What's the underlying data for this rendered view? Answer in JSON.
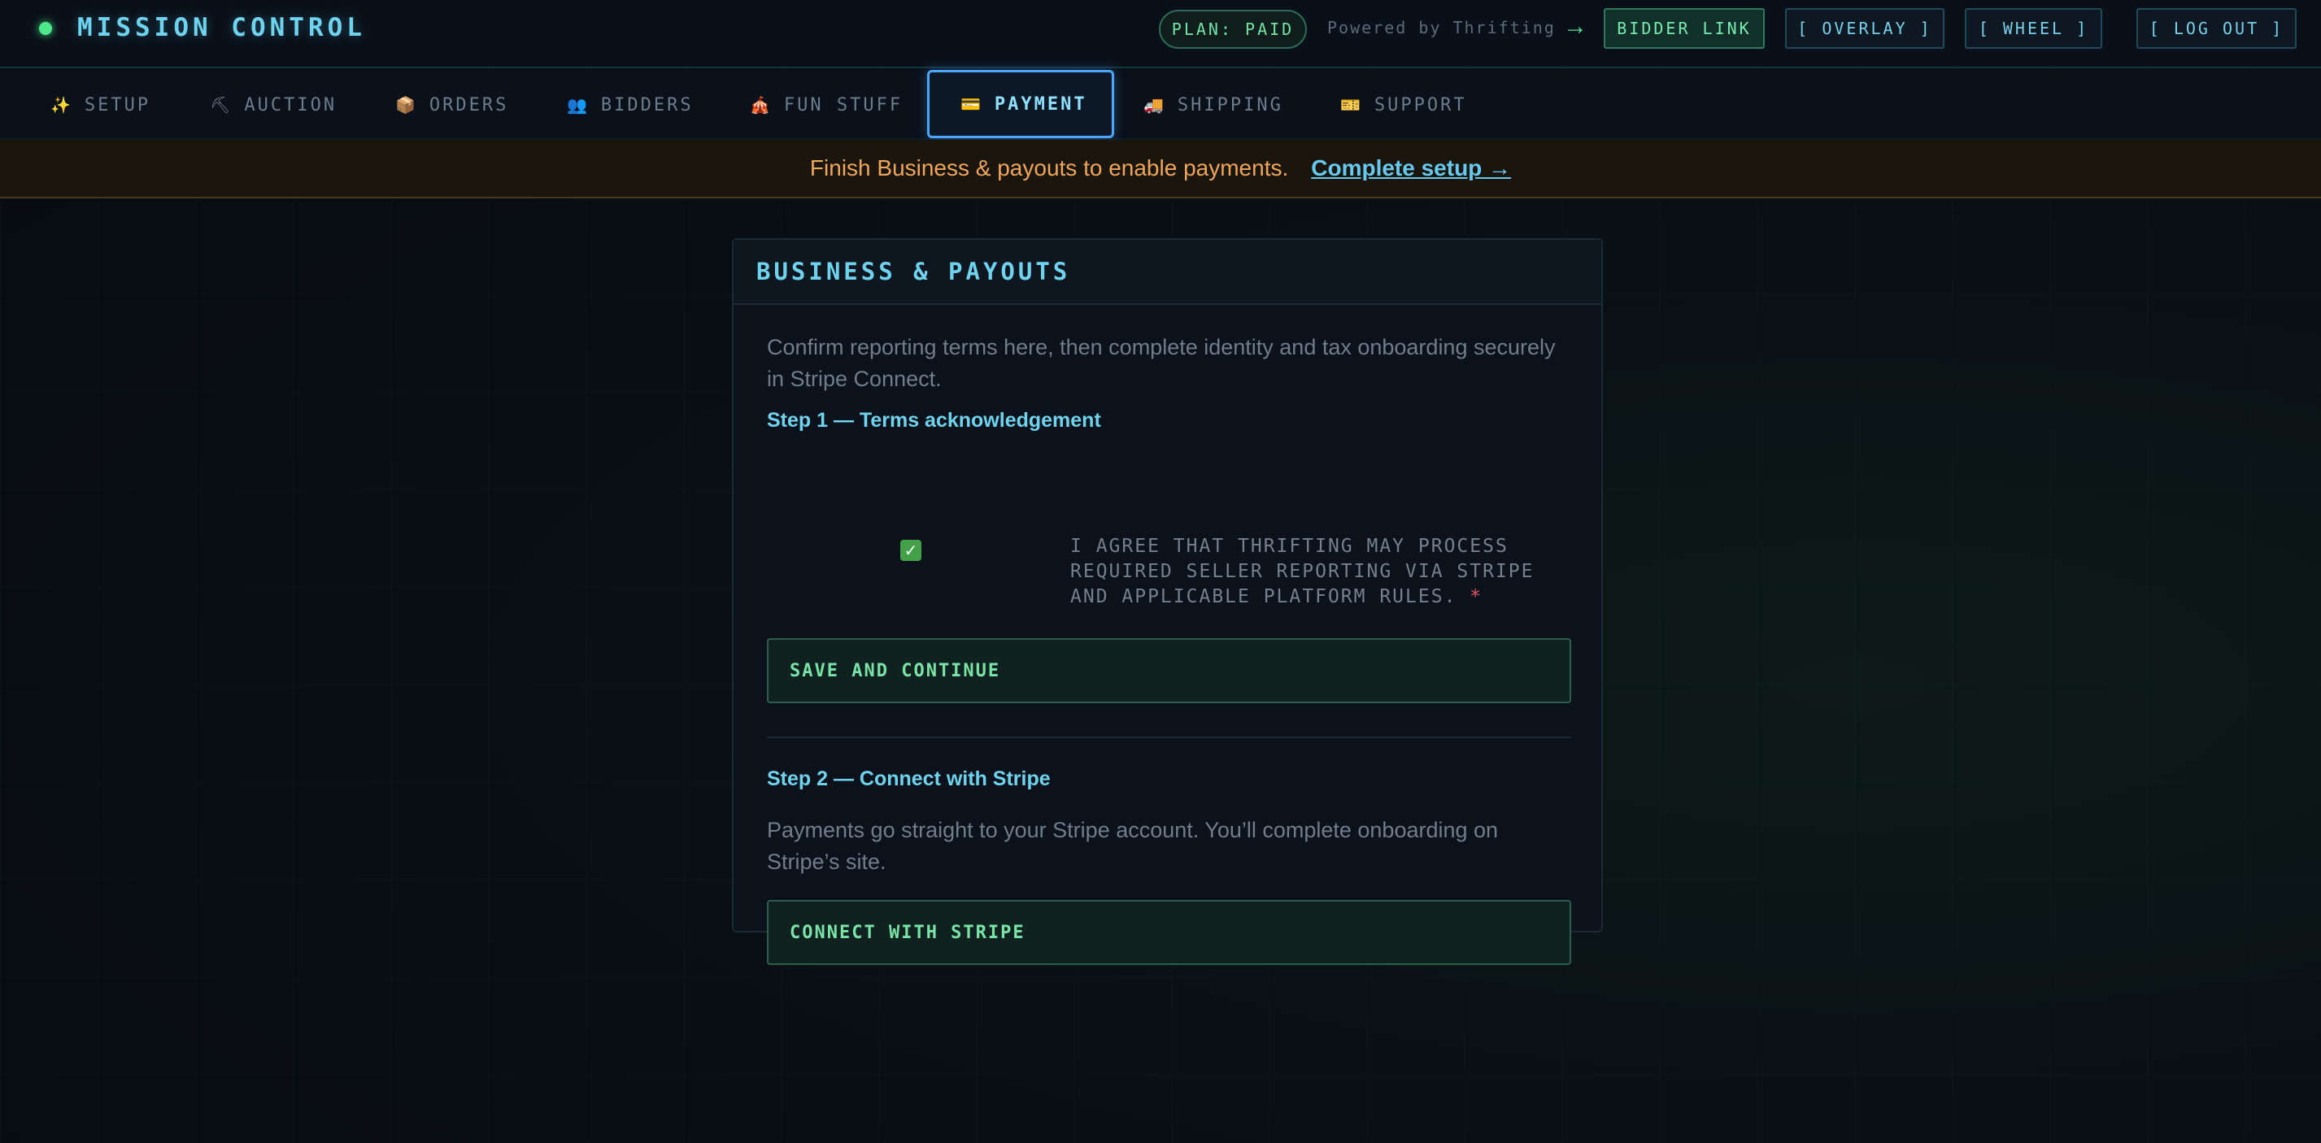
{
  "header": {
    "brand": "MISSION CONTROL",
    "plan": "PLAN: PAID",
    "powered_by": "Powered by Thrifting",
    "buttons": {
      "bidder_link": "BIDDER LINK",
      "overlay": "[ OVERLAY ]",
      "wheel": "[ WHEEL ]",
      "logout": "[ LOG OUT ]"
    }
  },
  "nav": {
    "tabs": [
      {
        "icon": "✨",
        "label": "SETUP"
      },
      {
        "icon": "⛏",
        "label": "AUCTION"
      },
      {
        "icon": "📦",
        "label": "ORDERS"
      },
      {
        "icon": "👥",
        "label": "BIDDERS"
      },
      {
        "icon": "🎪",
        "label": "FUN STUFF"
      },
      {
        "icon": "💳",
        "label": "PAYMENT"
      },
      {
        "icon": "🚚",
        "label": "SHIPPING"
      },
      {
        "icon": "🎫",
        "label": "SUPPORT"
      }
    ],
    "active": "PAYMENT"
  },
  "banner": {
    "message": "Finish Business & payouts to enable payments.",
    "link": "Complete setup →"
  },
  "card": {
    "title": "BUSINESS & PAYOUTS",
    "intro": "Confirm reporting terms here, then complete identity and tax onboarding securely in Stripe Connect.",
    "step1": {
      "title": "Step 1 — Terms acknowledgement",
      "checkbox_checked": true,
      "agree_label": "I AGREE THAT THRIFTING MAY PROCESS REQUIRED SELLER REPORTING VIA STRIPE AND APPLICABLE PLATFORM RULES.",
      "required_mark": "*",
      "button": "SAVE AND CONTINUE"
    },
    "step2": {
      "title": "Step 2 — Connect with Stripe",
      "desc": "Payments go straight to your Stripe account. You’ll complete onboarding on Stripe’s site.",
      "button": "CONNECT WITH STRIPE"
    }
  },
  "colors": {
    "accent_cyan": "#6fd3ee",
    "accent_green": "#7ae4a8",
    "warning": "#f0a65a",
    "tab_active_border": "#4aa7ff"
  }
}
